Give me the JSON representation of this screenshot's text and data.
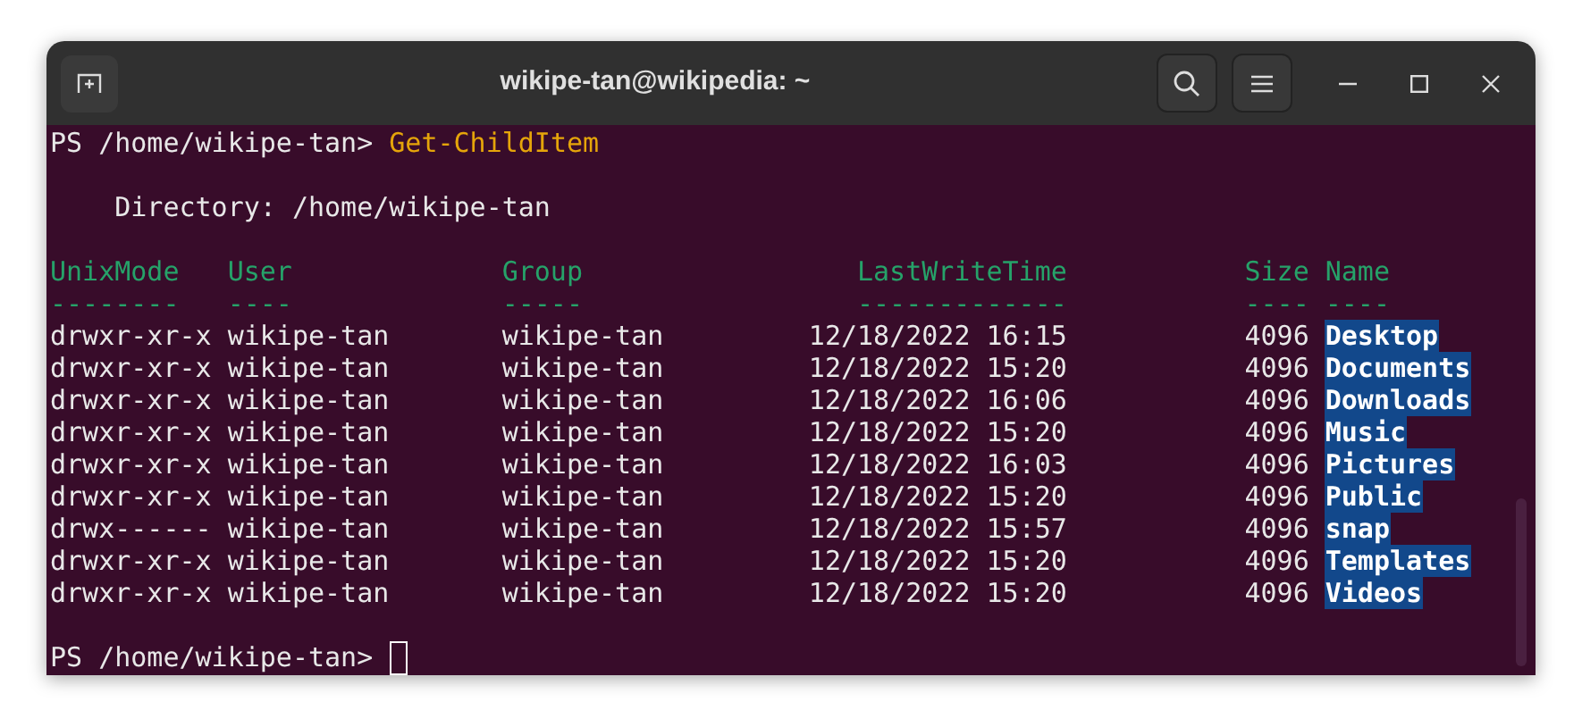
{
  "window": {
    "title": "wikipe-tan@wikipedia: ~"
  },
  "terminal": {
    "command_line": {
      "prompt": "PS /home/wikipe-tan>",
      "command": "Get-ChildItem"
    },
    "directory_line": "Directory: /home/wikipe-tan",
    "table": {
      "columns": [
        {
          "label": "UnixMode",
          "underline": "--------"
        },
        {
          "label": "User",
          "underline": "----"
        },
        {
          "label": "Group",
          "underline": "-----"
        },
        {
          "label": "LastWriteTime",
          "underline": "-------------"
        },
        {
          "label": "Size",
          "underline": "----"
        },
        {
          "label": "Name",
          "underline": "----"
        }
      ],
      "rows": [
        [
          "drwxr-xr-x",
          "wikipe-tan",
          "wikipe-tan",
          "12/18/2022 16:15",
          "4096",
          "Desktop"
        ],
        [
          "drwxr-xr-x",
          "wikipe-tan",
          "wikipe-tan",
          "12/18/2022 15:20",
          "4096",
          "Documents"
        ],
        [
          "drwxr-xr-x",
          "wikipe-tan",
          "wikipe-tan",
          "12/18/2022 16:06",
          "4096",
          "Downloads"
        ],
        [
          "drwxr-xr-x",
          "wikipe-tan",
          "wikipe-tan",
          "12/18/2022 15:20",
          "4096",
          "Music"
        ],
        [
          "drwxr-xr-x",
          "wikipe-tan",
          "wikipe-tan",
          "12/18/2022 16:03",
          "4096",
          "Pictures"
        ],
        [
          "drwxr-xr-x",
          "wikipe-tan",
          "wikipe-tan",
          "12/18/2022 15:20",
          "4096",
          "Public"
        ],
        [
          "drwx------",
          "wikipe-tan",
          "wikipe-tan",
          "12/18/2022 15:57",
          "4096",
          "snap"
        ],
        [
          "drwxr-xr-x",
          "wikipe-tan",
          "wikipe-tan",
          "12/18/2022 15:20",
          "4096",
          "Templates"
        ],
        [
          "drwxr-xr-x",
          "wikipe-tan",
          "wikipe-tan",
          "12/18/2022 15:20",
          "4096",
          "Videos"
        ]
      ]
    },
    "prompt": "PS /home/wikipe-tan>"
  }
}
